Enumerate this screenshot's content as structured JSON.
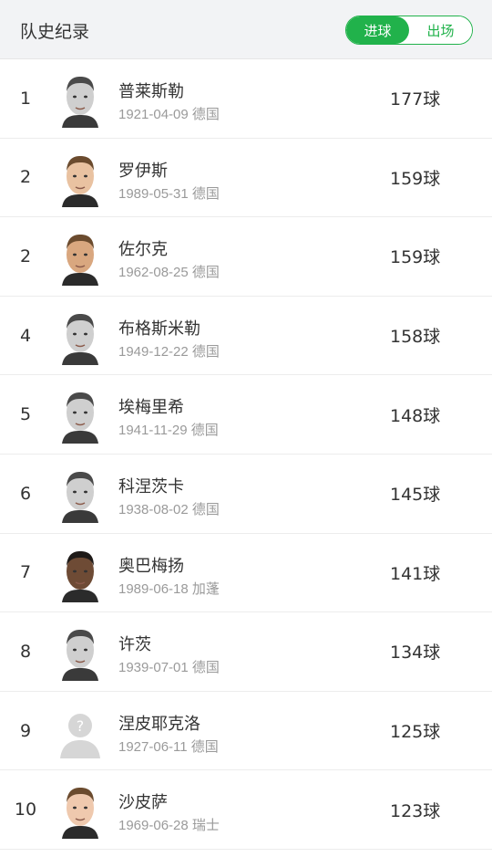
{
  "header": {
    "title": "队史纪录",
    "tabs": [
      {
        "label": "进球",
        "active": true
      },
      {
        "label": "出场",
        "active": false
      }
    ],
    "accent_color": "#21b24b"
  },
  "players": [
    {
      "rank": "1",
      "name": "普莱斯勒",
      "birth": "1921-04-09",
      "country": "德国",
      "goals": "177球",
      "photo": "bw-portrait"
    },
    {
      "rank": "2",
      "name": "罗伊斯",
      "birth": "1989-05-31",
      "country": "德国",
      "goals": "159球",
      "photo": "color-portrait"
    },
    {
      "rank": "2",
      "name": "佐尔克",
      "birth": "1962-08-25",
      "country": "德国",
      "goals": "159球",
      "photo": "color-portrait"
    },
    {
      "rank": "4",
      "name": "布格斯米勒",
      "birth": "1949-12-22",
      "country": "德国",
      "goals": "158球",
      "photo": "bw-portrait"
    },
    {
      "rank": "5",
      "name": "埃梅里希",
      "birth": "1941-11-29",
      "country": "德国",
      "goals": "148球",
      "photo": "bw-portrait"
    },
    {
      "rank": "6",
      "name": "科涅茨卡",
      "birth": "1938-08-02",
      "country": "德国",
      "goals": "145球",
      "photo": "bw-portrait"
    },
    {
      "rank": "7",
      "name": "奥巴梅扬",
      "birth": "1989-06-18",
      "country": "加蓬",
      "goals": "141球",
      "photo": "color-portrait"
    },
    {
      "rank": "8",
      "name": "许茨",
      "birth": "1939-07-01",
      "country": "德国",
      "goals": "134球",
      "photo": "bw-portrait"
    },
    {
      "rank": "9",
      "name": "涅皮耶克洛",
      "birth": "1927-06-11",
      "country": "德国",
      "goals": "125球",
      "photo": "placeholder-avatar"
    },
    {
      "rank": "10",
      "name": "沙皮萨",
      "birth": "1969-06-28",
      "country": "瑞士",
      "goals": "123球",
      "photo": "color-portrait"
    }
  ]
}
